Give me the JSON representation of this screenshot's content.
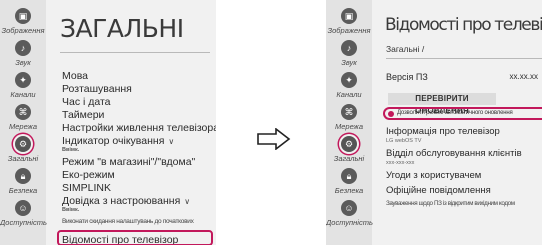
{
  "left_screen": {
    "title": "ЗАГАЛЬНІ",
    "rail": [
      {
        "icon": "picture-icon",
        "label": "Зображення"
      },
      {
        "icon": "sound-icon",
        "label": "Звук"
      },
      {
        "icon": "channels-icon",
        "label": "Канали"
      },
      {
        "icon": "network-icon",
        "label": "Мережа"
      },
      {
        "icon": "general-icon",
        "label": "Загальні"
      },
      {
        "icon": "lock-icon",
        "label": "Безпека"
      },
      {
        "icon": "accessibility-icon",
        "label": "Доступність"
      }
    ],
    "menu": {
      "language": "Мова",
      "location": "Розташування",
      "time_date": "Час і дата",
      "timers": "Таймери",
      "power": "Настройки живлення телевізора",
      "standby_indicator": "Індикатор очікування",
      "standby_indicator_value": "Ввімк.",
      "mode": "Режим \"в магазині\"/\"вдома\"",
      "eco": "Еко-режим",
      "simplink": "SIMPLINK",
      "setup_help": "Довідка з настроювання",
      "setup_help_value": "Ввімк.",
      "reset": "Виконати скидання налаштувань до початкових",
      "tv_info": "Відомості про телевізор"
    }
  },
  "right_screen": {
    "title": "Відомості про телевізор",
    "breadcrumb": "Загальні /",
    "sw_version_label": "Версія ПЗ",
    "sw_version_value": "xx.xx.xx",
    "check_updates": "ПЕРЕВІРИТИ ОНОВЛЕННЯ",
    "auto_update": "Дозволити режим автоматичного оновлення",
    "tv_info_label": "Інформація про телевізор",
    "tv_info_sub": "LG webOS TV",
    "service_label": "Відділ обслуговування клієнтів",
    "service_sub": "xxx-xxx-xxx",
    "terms": "Угоди з користувачем",
    "notices": "Офіційне повідомлення",
    "legal_note": "Зауваження щодо ПЗ із відкритим вихідним кодом"
  },
  "colors": {
    "highlight": "#c2185b",
    "panel": "#f1f1f1",
    "rail": "#e3e3e3"
  }
}
